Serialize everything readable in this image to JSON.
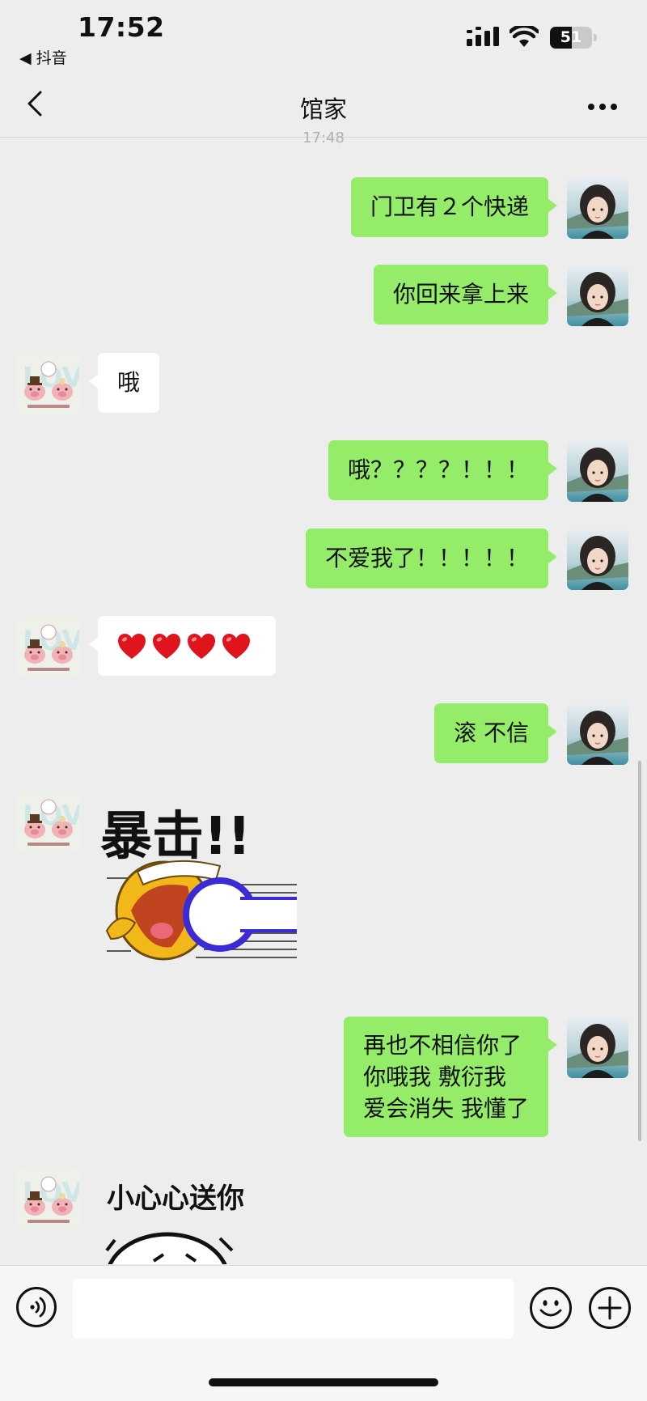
{
  "status_bar": {
    "time": "17:52",
    "back_app": "◀ 抖音",
    "battery_level": "51",
    "battery_percent": 51
  },
  "header": {
    "title": "馆家"
  },
  "timestamp": "17:48",
  "messages": [
    {
      "side": "me",
      "text": "门卫有２个快递"
    },
    {
      "side": "me",
      "text": "你回来拿上来"
    },
    {
      "side": "them",
      "text": "哦"
    },
    {
      "side": "me",
      "text": "哦？？？？！！！"
    },
    {
      "side": "me",
      "text": "不爱我了！！！！！"
    },
    {
      "side": "them",
      "type": "hearts",
      "count": 4
    },
    {
      "side": "me",
      "text": "滚 不信"
    },
    {
      "side": "them",
      "type": "sticker",
      "sticker_text": "暴击!!"
    },
    {
      "side": "me",
      "lines": [
        "再也不相信你了",
        "你哦我 敷衍我",
        "爱会消失 我懂了"
      ]
    },
    {
      "side": "them",
      "type": "sticker",
      "sticker_text": "小心心送你"
    }
  ],
  "input": {
    "placeholder": ""
  },
  "colors": {
    "background": "#ededed",
    "my_bubble": "#95ec69",
    "their_bubble": "#ffffff"
  }
}
